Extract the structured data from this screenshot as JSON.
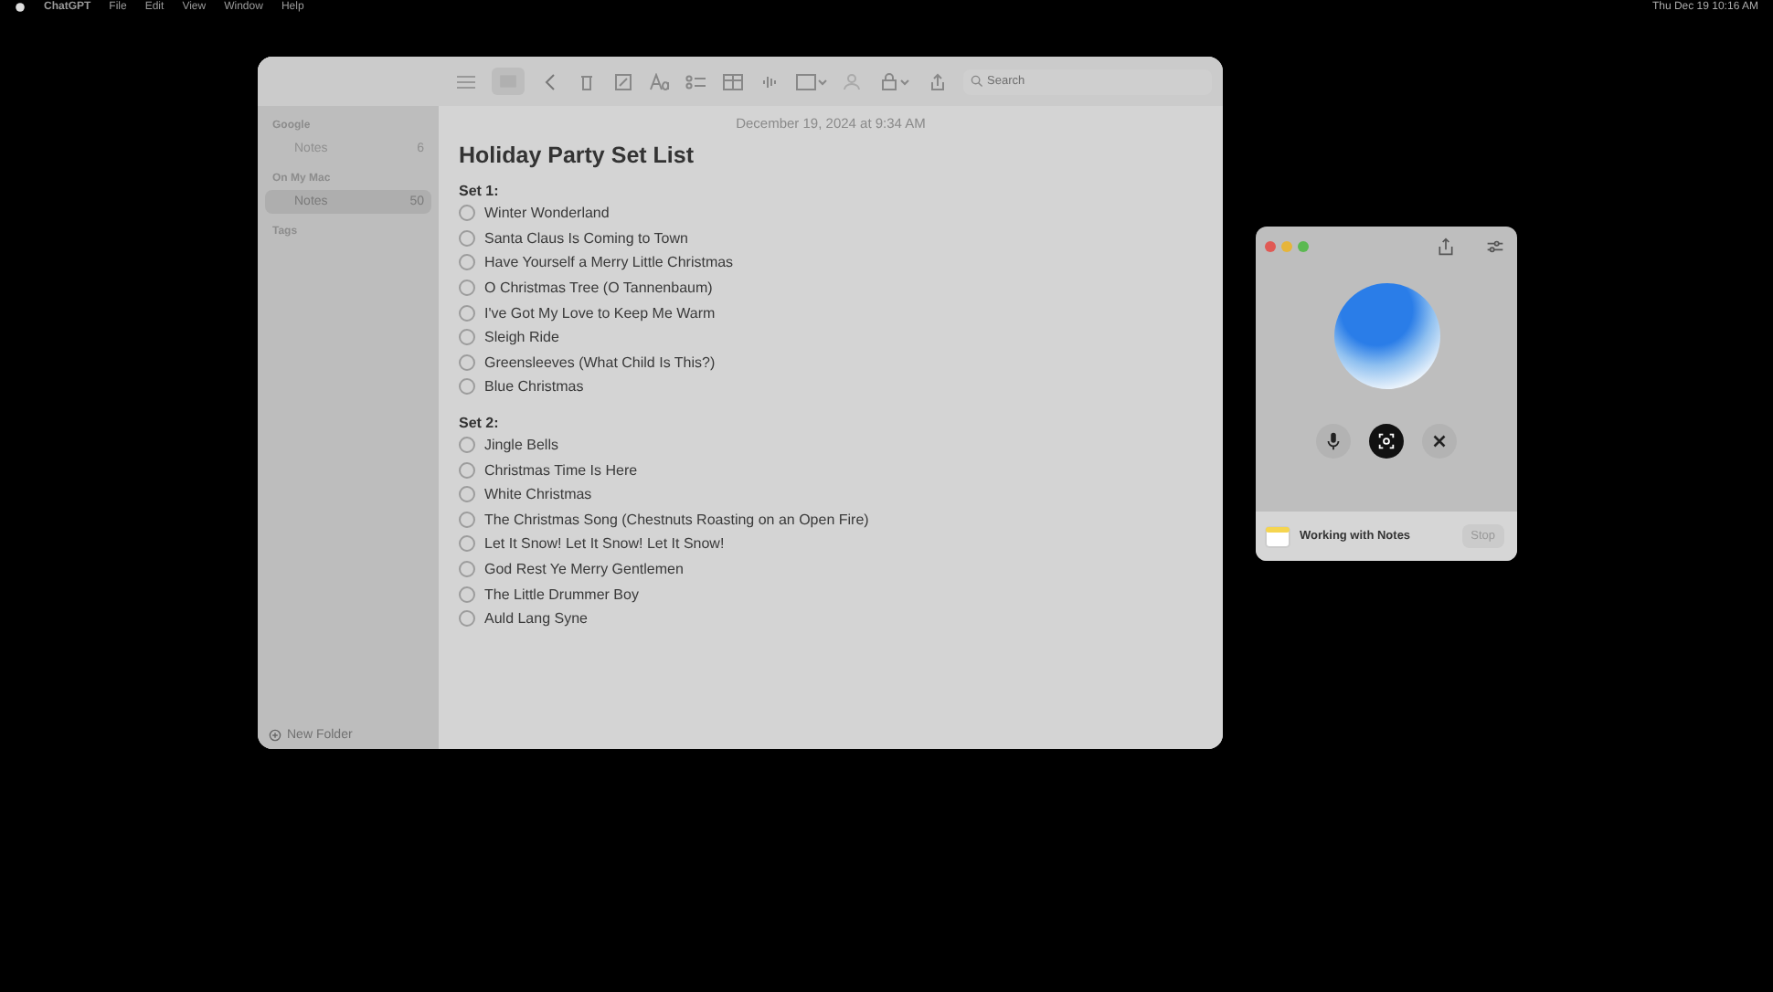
{
  "menu_bar": {
    "app_name": "ChatGPT",
    "menus": [
      "File",
      "Edit",
      "View",
      "Window",
      "Help"
    ],
    "clock": "Thu Dec 19  10:16 AM"
  },
  "notes_window": {
    "search": {
      "placeholder": "Search"
    },
    "sidebar": {
      "sections": [
        {
          "title": "Google",
          "folders": [
            {
              "name": "Notes",
              "count": "6",
              "selected": false
            }
          ]
        },
        {
          "title": "On My Mac",
          "folders": [
            {
              "name": "Notes",
              "count": "50",
              "selected": true
            }
          ]
        },
        {
          "title": "Tags"
        }
      ],
      "new_folder": "New Folder"
    },
    "note": {
      "date": "December 19, 2024 at 9:34 AM",
      "title": "Holiday Party Set List",
      "sets": [
        {
          "heading": "Set 1:",
          "items": [
            {
              "text": "Winter Wonderland",
              "checked": false
            },
            {
              "text": "Santa Claus Is Coming to Town",
              "checked": false
            },
            {
              "text": "Have Yourself a Merry Little Christmas",
              "checked": false
            },
            {
              "text": "O Christmas Tree (O Tannenbaum)",
              "checked": false
            },
            {
              "text": "I've Got My Love to Keep Me Warm",
              "checked": false
            },
            {
              "text": "Sleigh Ride",
              "checked": false
            },
            {
              "text": "Greensleeves (What Child Is This?)",
              "checked": false
            },
            {
              "text": "Blue Christmas",
              "checked": false
            }
          ]
        },
        {
          "heading": "Set 2:",
          "items": [
            {
              "text": "Jingle Bells",
              "checked": false
            },
            {
              "text": "Christmas Time Is Here",
              "checked": false
            },
            {
              "text": "White Christmas",
              "checked": false
            },
            {
              "text": "The Christmas Song (Chestnuts Roasting on an Open Fire)",
              "checked": false
            },
            {
              "text": "Let It Snow! Let It Snow! Let It Snow!",
              "checked": false
            },
            {
              "text": "God Rest Ye Merry Gentlemen",
              "checked": false
            },
            {
              "text": "The Little Drummer Boy",
              "checked": false
            },
            {
              "text": "Auld Lang Syne",
              "checked": false
            }
          ]
        }
      ]
    }
  },
  "voice_window": {
    "status": {
      "label": "Working with Notes",
      "button": "Stop"
    }
  }
}
